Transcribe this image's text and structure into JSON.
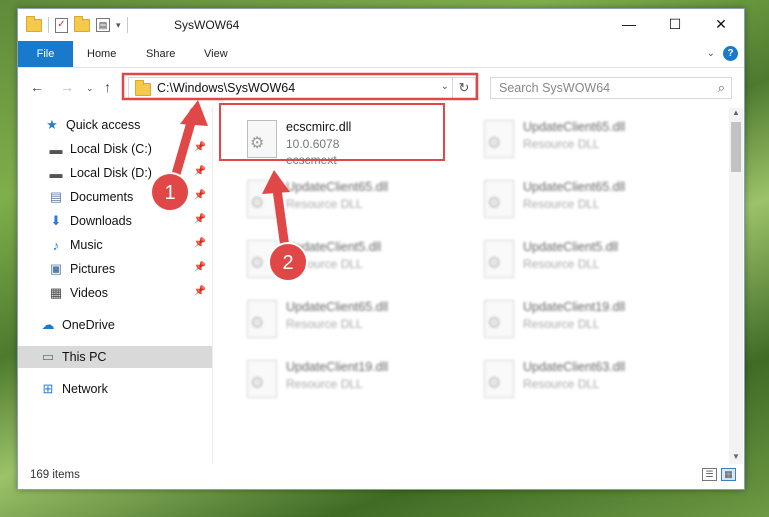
{
  "window": {
    "title": "SysWOW64",
    "minimize_icon": "minimize-icon",
    "maximize_icon": "maximize-icon",
    "close_icon": "close-icon"
  },
  "ribbon": {
    "tabs": [
      "File",
      "Home",
      "Share",
      "View"
    ],
    "file_tab_color": "#1979ca"
  },
  "navigation": {
    "address": "C:\\Windows\\SysWOW64",
    "search_placeholder": "Search SysWOW64"
  },
  "sidebar": {
    "items": [
      {
        "label": "Quick access",
        "icon": "star-icon"
      },
      {
        "label": "Local Disk (C:)",
        "icon": "drive-icon",
        "pinned": true
      },
      {
        "label": "Local Disk (D:)",
        "icon": "drive-icon",
        "pinned": true
      },
      {
        "label": "Documents",
        "icon": "documents-icon",
        "pinned": true
      },
      {
        "label": "Downloads",
        "icon": "download-icon",
        "pinned": true
      },
      {
        "label": "Music",
        "icon": "music-icon",
        "pinned": true
      },
      {
        "label": "Pictures",
        "icon": "pictures-icon",
        "pinned": true
      },
      {
        "label": "Videos",
        "icon": "videos-icon",
        "pinned": true
      },
      {
        "label": "OneDrive",
        "icon": "cloud-icon"
      },
      {
        "label": "This PC",
        "icon": "computer-icon",
        "selected": true
      },
      {
        "label": "Network",
        "icon": "network-icon"
      }
    ]
  },
  "files": [
    {
      "name": "ecscmirc.dll",
      "version": "10.0.6078",
      "description": "ecscmext",
      "highlighted": true
    },
    {
      "name": "UpdateClient65.dll",
      "description": "Resource DLL"
    },
    {
      "name": "UpdateClient65.dll",
      "description": "Resource DLL"
    },
    {
      "name": "UpdateClient65.dll",
      "description": "Resource DLL"
    },
    {
      "name": "UpdateClient5.dll",
      "description": "Resource DLL"
    },
    {
      "name": "UpdateClient5.dll",
      "description": "Resource DLL"
    },
    {
      "name": "UpdateClient65.dll",
      "description": "Resource DLL"
    },
    {
      "name": "UpdateClient19.dll",
      "description": "Resource DLL"
    },
    {
      "name": "UpdateClient19.dll",
      "description": "Resource DLL"
    },
    {
      "name": "UpdateClient63.dll",
      "description": "Resource DLL"
    }
  ],
  "status": {
    "item_count": "169 items"
  },
  "annotations": {
    "markers": [
      "1",
      "2"
    ],
    "color": "#e04848"
  }
}
